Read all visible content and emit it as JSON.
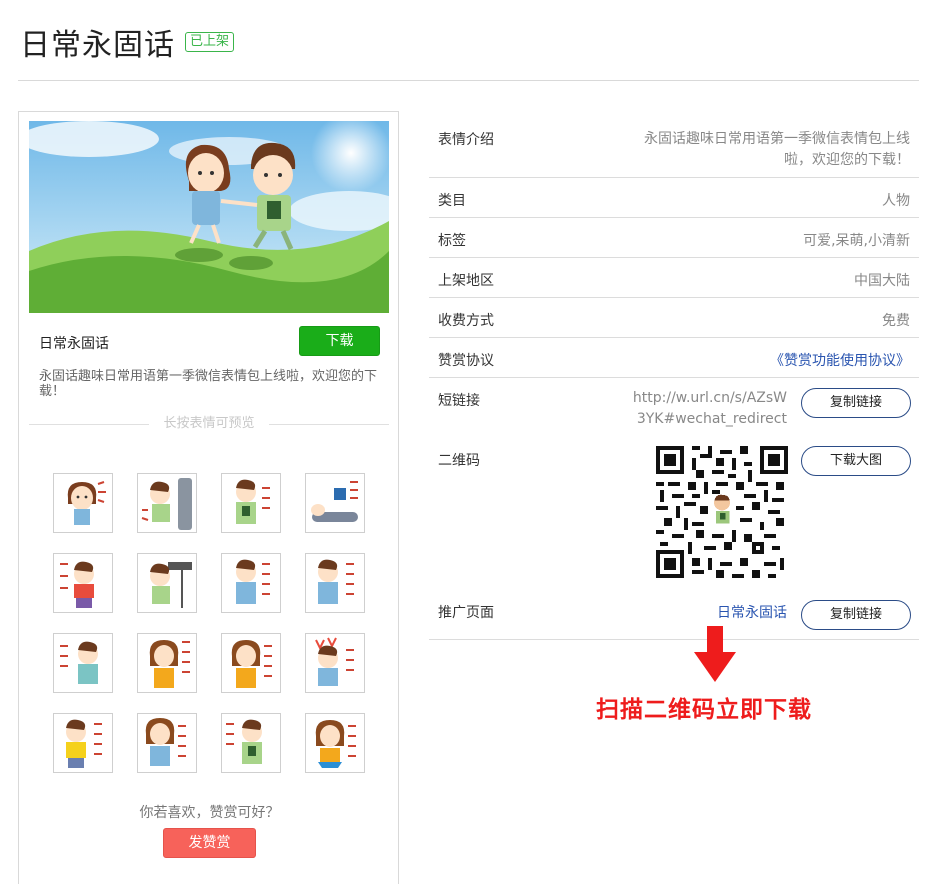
{
  "header": {
    "title": "日常永固话",
    "status_badge": "已上架"
  },
  "left": {
    "pack_name": "日常永固话",
    "download_label": "下载",
    "description": "永固话趣味日常用语第一季微信表情包上线啦，欢迎您的下载！",
    "preview_hint": "长按表情可预览",
    "appreciate_text": "你若喜欢，赞赏可好？",
    "reward_label": "发赞赏"
  },
  "info": {
    "intro_label": "表情介绍",
    "intro_value_line1": "永固话趣味日常用语第一季微信表情包上线",
    "intro_value_line2": "啦，欢迎您的下载！",
    "category_label": "类目",
    "category_value": "人物",
    "tags_label": "标签",
    "tags_value": "可爱,呆萌,小清新",
    "region_label": "上架地区",
    "region_value": "中国大陆",
    "pricing_label": "收费方式",
    "pricing_value": "免费",
    "agreement_label": "赞赏协议",
    "agreement_value": "《赞赏功能使用协议》",
    "shortlink_label": "短链接",
    "shortlink_line1": "http://w.url.cn/s/AZsW",
    "shortlink_line2": "3YK#wechat_redirect",
    "copy_link_label": "复制链接",
    "qrcode_label": "二维码",
    "download_big_label": "下载大图",
    "promo_label": "推广页面",
    "promo_value": "日常永固话",
    "promo_copy_label": "复制链接"
  },
  "annotation": {
    "scan_tip": "扫描二维码立即下载"
  },
  "colors": {
    "green": "#1aad19",
    "red": "#ee1c1c",
    "reward": "#f7625a",
    "link": "#2a55b0"
  }
}
